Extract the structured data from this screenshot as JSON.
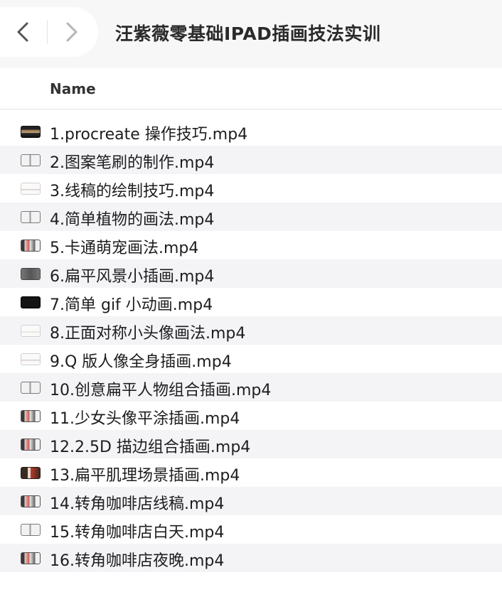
{
  "window": {
    "title": "汪紫薇零基础IPAD插画技法实训"
  },
  "navigation": {
    "back_icon": "chevron-left-icon",
    "forward_icon": "chevron-right-icon"
  },
  "table": {
    "column_name_label": "Name"
  },
  "files": [
    {
      "name": "1.procreate 操作技巧.mp4",
      "thumb": "dark-photo"
    },
    {
      "name": "2.图案笔刷的制作.mp4",
      "thumb": "light-split"
    },
    {
      "name": "3.线稿的绘制技巧.mp4",
      "thumb": "white-line"
    },
    {
      "name": "4.简单植物的画法.mp4",
      "thumb": "light-split"
    },
    {
      "name": "5.卡通萌宠画法.mp4",
      "thumb": "color-mix"
    },
    {
      "name": "6.扁平风景小插画.mp4",
      "thumb": "gray-dark"
    },
    {
      "name": "7.简单 gif 小动画.mp4",
      "thumb": "black"
    },
    {
      "name": "8.正面对称小头像画法.mp4",
      "thumb": "white-line"
    },
    {
      "name": "9.Q 版人像全身插画.mp4",
      "thumb": "white-line"
    },
    {
      "name": "10.创意扁平人物组合插画.mp4",
      "thumb": "light-split"
    },
    {
      "name": "11.少女头像平涂插画.mp4",
      "thumb": "color-mix"
    },
    {
      "name": "12.2.5D 描边组合插画.mp4",
      "thumb": "color-mix"
    },
    {
      "name": "13.扁平肌理场景插画.mp4",
      "thumb": "warm-dark"
    },
    {
      "name": "14.转角咖啡店线稿.mp4",
      "thumb": "color-mix"
    },
    {
      "name": "15.转角咖啡店白天.mp4",
      "thumb": "light-split"
    },
    {
      "name": "16.转角咖啡店夜晚.mp4",
      "thumb": "color-mix"
    }
  ],
  "colors": {
    "row_alt": "#f4f4f6",
    "background": "#f7f7f7",
    "text": "#1d1d1f"
  }
}
